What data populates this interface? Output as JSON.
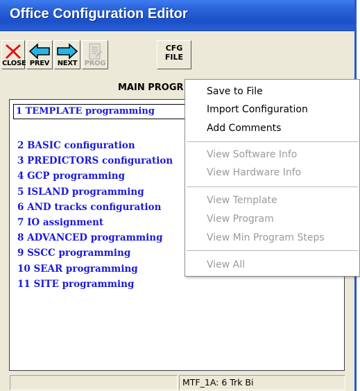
{
  "window": {
    "title": "Office Configuration Editor"
  },
  "toolbar": {
    "close_label": "CLOSE",
    "prev_label": "PREV",
    "next_label": "NEXT",
    "prog_label": "PROG",
    "cfg_label_line1": "CFG",
    "cfg_label_line2": "FILE"
  },
  "main": {
    "title": "MAIN PROGR",
    "selected_item": "1 TEMPLATE programming",
    "items": [
      "2 BASIC configuration",
      "3 PREDICTORS configuration",
      "4 GCP programming",
      "5 ISLAND programming",
      "6 AND tracks configuration",
      "7 IO assignment",
      "8 ADVANCED programming",
      "9 SSCC programming",
      "10 SEAR programming",
      "11 SITE programming"
    ]
  },
  "status": {
    "left": "",
    "right": "MTF_1A: 6 Trk Bi"
  },
  "context_menu": {
    "items": [
      {
        "label": "Save to File",
        "enabled": true
      },
      {
        "label": "Import Configuration",
        "enabled": true
      },
      {
        "label": "Add Comments",
        "enabled": true
      },
      {
        "label": "View Software Info",
        "enabled": false
      },
      {
        "label": "View Hardware Info",
        "enabled": false
      },
      {
        "label": "View Template",
        "enabled": false
      },
      {
        "label": "View Program",
        "enabled": false
      },
      {
        "label": "View Min Program Steps",
        "enabled": false
      },
      {
        "label": "View All",
        "enabled": false
      }
    ]
  },
  "colors": {
    "titlebar": "#2a63d8",
    "item_text": "#1a1ad8",
    "disabled_text": "#9a9a9a",
    "window_bg": "#ece9d8"
  },
  "icons": {
    "close": "red-x-icon",
    "prev": "left-arrow-icon",
    "next": "right-arrow-icon",
    "prog": "document-icon"
  }
}
